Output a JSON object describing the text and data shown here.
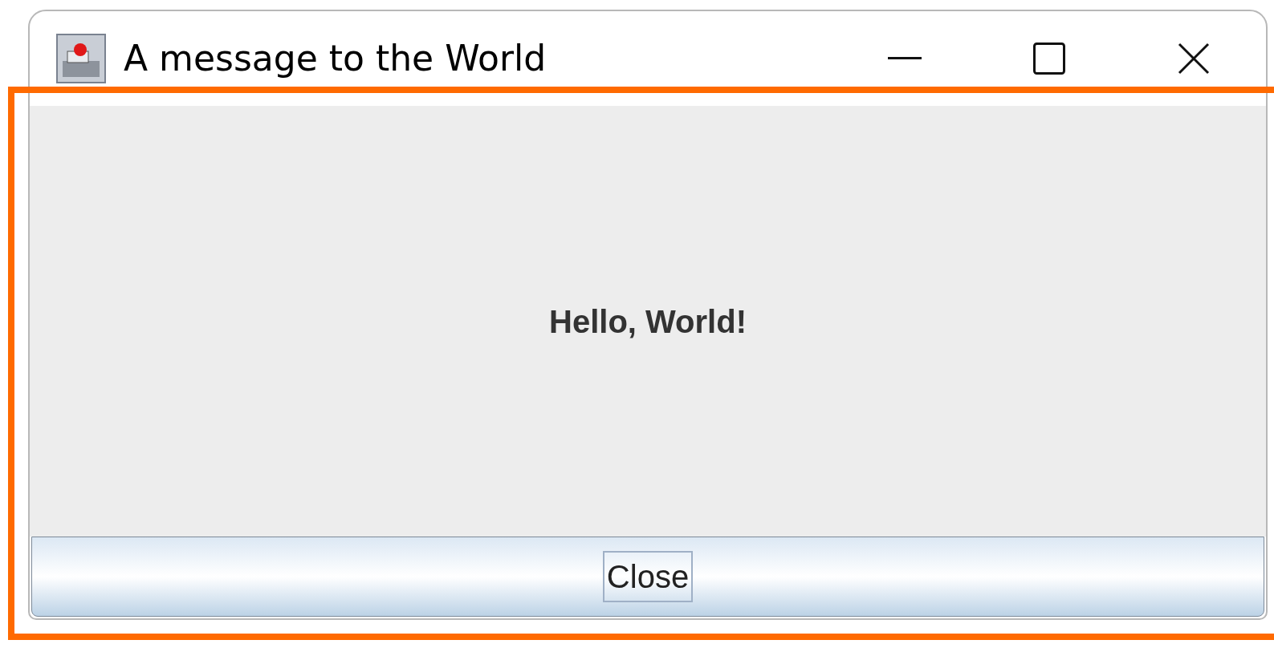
{
  "window": {
    "title": "A message to the World"
  },
  "message": "Hello, World!",
  "buttons": [
    {
      "label": "Close",
      "focused": true
    }
  ]
}
